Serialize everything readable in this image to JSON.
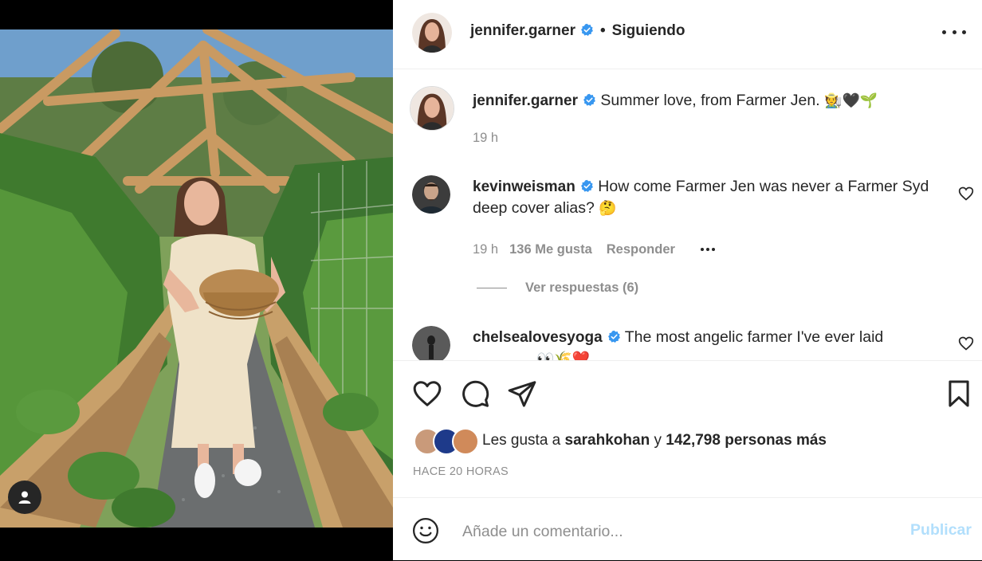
{
  "post": {
    "author": "jennifer.garner",
    "follow_status": "Siguiendo",
    "separator": "•"
  },
  "caption": {
    "author": "jennifer.garner",
    "text": "Summer love, from Farmer Jen.",
    "emojis": "🧑‍🌾🖤🌱",
    "time": "19 h"
  },
  "comments": [
    {
      "author": "kevinweisman",
      "text": "How come Farmer Jen was never a Farmer Syd deep cover alias?",
      "emoji": "🤔",
      "time": "19 h",
      "likes": "136 Me gusta",
      "reply": "Responder",
      "view_replies": "Ver respuestas (6)"
    },
    {
      "author": "chelsealovesyoga",
      "text": "The most angelic farmer I've ever laid",
      "emoji_partial": "👀🌾❤️"
    }
  ],
  "likes": {
    "prefix": "Les gusta a",
    "user": "sarahkohan",
    "connector": "y",
    "count": "142,798 personas más"
  },
  "date": "HACE 20 HORAS",
  "comment_box": {
    "placeholder": "Añade un comentario...",
    "publish": "Publicar"
  },
  "colors": {
    "verified": "#3897f0",
    "publish_disabled": "#b2dffc",
    "muted": "#8e8e8e"
  },
  "icons": [
    "heart-icon",
    "comment-icon",
    "share-icon",
    "bookmark-icon",
    "emoji-icon",
    "more-icon",
    "user-tag-icon",
    "verified-icon"
  ]
}
